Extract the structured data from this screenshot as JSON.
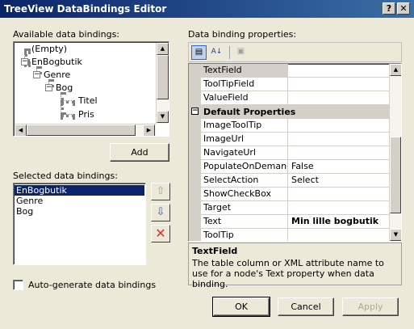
{
  "window": {
    "title": "TreeView DataBindings Editor",
    "help_label": "?",
    "close_label": "✕"
  },
  "available": {
    "label": "Available data bindings:",
    "tree": [
      {
        "label": "(Empty)"
      },
      {
        "label": "EnBogbutik"
      },
      {
        "label": "Genre"
      },
      {
        "label": "Bog"
      },
      {
        "label": "Titel"
      },
      {
        "label": "Pris"
      }
    ],
    "add_label": "Add"
  },
  "selected": {
    "label": "Selected data bindings:",
    "items": [
      "EnBogbutik",
      "Genre",
      "Bog"
    ],
    "selected_index": 0
  },
  "props": {
    "label": "Data binding properties:",
    "rows_top": [
      {
        "name": "TextField",
        "value": ""
      },
      {
        "name": "ToolTipField",
        "value": ""
      },
      {
        "name": "ValueField",
        "value": ""
      }
    ],
    "category": "Default Properties",
    "rows": [
      {
        "name": "ImageToolTip",
        "value": ""
      },
      {
        "name": "ImageUrl",
        "value": ""
      },
      {
        "name": "NavigateUrl",
        "value": ""
      },
      {
        "name": "PopulateOnDemand",
        "value": "False"
      },
      {
        "name": "SelectAction",
        "value": "Select"
      },
      {
        "name": "ShowCheckBox",
        "value": ""
      },
      {
        "name": "Target",
        "value": ""
      },
      {
        "name": "Text",
        "value": "Min lille bogbutik"
      },
      {
        "name": "ToolTip",
        "value": ""
      }
    ],
    "description_title": "TextField",
    "description_text": "The table column or XML attribute name to use for a node's Text property when data binding."
  },
  "autogen_label": "Auto-generate data bindings",
  "buttons": {
    "ok": "OK",
    "cancel": "Cancel",
    "apply": "Apply"
  },
  "colors": {
    "title_start": "#0a246a",
    "title_end": "#3a6ea5",
    "selection": "#0a246a",
    "delete_red": "#e03020",
    "arrow_blue": "#2a5fd0"
  }
}
